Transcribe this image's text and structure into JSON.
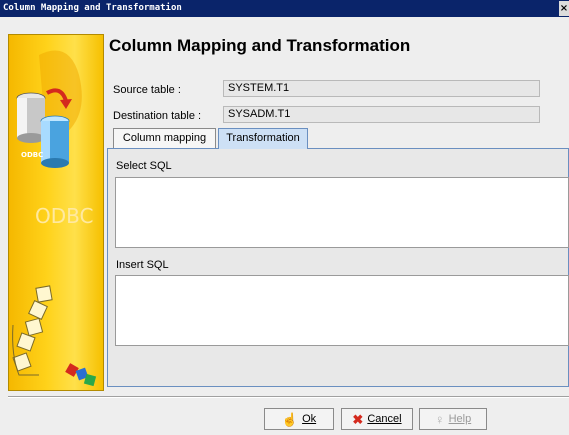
{
  "window": {
    "title": "Column Mapping and Transformation"
  },
  "sidebar": {
    "brand_text": "ODBC",
    "icons": [
      "database-cylinders-icon",
      "red-arrow-icon",
      "puzzle-tower-icon",
      "colored-cubes-icon"
    ]
  },
  "header": {
    "title": "Column Mapping and Transformation"
  },
  "form": {
    "source_label": "Source table :",
    "source_value": "SYSTEM.T1",
    "destination_label": "Destination table :",
    "destination_value": "SYSADM.T1"
  },
  "tabs": [
    {
      "label": "Column mapping",
      "active": false
    },
    {
      "label": "Transformation",
      "active": true
    }
  ],
  "transformation": {
    "select_sql_label": "Select SQL",
    "select_sql_value": "",
    "insert_sql_label": "Insert SQL",
    "insert_sql_value": ""
  },
  "buttons": {
    "ok": {
      "label": "Ok",
      "icon": "hand-pointer-icon"
    },
    "cancel": {
      "label": "Cancel",
      "icon": "red-x-icon"
    },
    "help": {
      "label": "Help",
      "icon": "lightbulb-icon",
      "disabled": true
    }
  },
  "colors": {
    "titlebar": "#0a246a",
    "sidebar": "#ffd21a",
    "active_tab": "#cde0f5"
  }
}
